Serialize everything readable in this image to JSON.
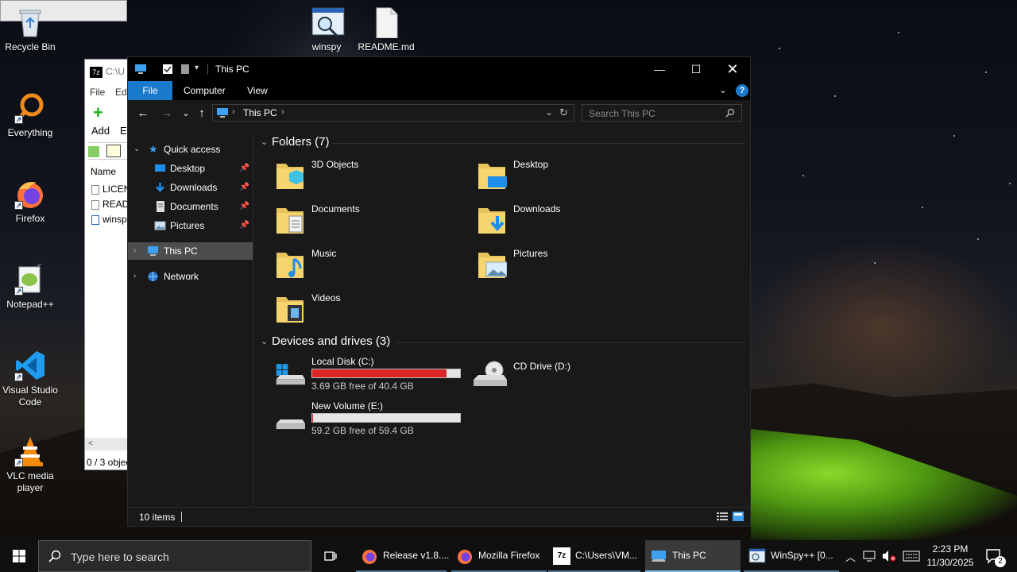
{
  "desktop": {
    "icons": [
      {
        "label": "Recycle Bin"
      },
      {
        "label": "Everything"
      },
      {
        "label": "Firefox"
      },
      {
        "label": "Notepad++"
      },
      {
        "label": "Visual Studio Code"
      },
      {
        "label": "VLC media player"
      },
      {
        "label": "winspy"
      },
      {
        "label": "README.md"
      }
    ]
  },
  "sevenzip": {
    "title": "C:\\U",
    "menu_file": "File",
    "menu_edit": "Edi",
    "add_label": "Add",
    "extract_label": "Ex",
    "col_name": "Name",
    "rows": [
      "LICEN",
      "READ",
      "winsp"
    ],
    "status": "0 / 3 objec"
  },
  "explorer": {
    "title": "This PC",
    "tabs": {
      "file": "File",
      "computer": "Computer",
      "view": "View"
    },
    "address": {
      "path": "This PC"
    },
    "search": {
      "placeholder": "Search This PC"
    },
    "nav": {
      "quick_access": "Quick access",
      "desktop": "Desktop",
      "downloads": "Downloads",
      "documents": "Documents",
      "pictures": "Pictures",
      "this_pc": "This PC",
      "network": "Network"
    },
    "folders_header": "Folders (7)",
    "folders": [
      "3D Objects",
      "Desktop",
      "Documents",
      "Downloads",
      "Music",
      "Pictures",
      "Videos"
    ],
    "devices_header": "Devices and drives (3)",
    "drives": {
      "c": {
        "name": "Local Disk (C:)",
        "free": "3.69 GB free of 40.4 GB",
        "used_fraction": 0.909
      },
      "d": {
        "name": "CD Drive (D:)"
      },
      "e": {
        "name": "New Volume (E:)",
        "free": "59.2 GB free of 59.4 GB",
        "used_fraction": 0.003
      }
    },
    "status": "10 items"
  },
  "taskbar": {
    "search_placeholder": "Type here to search",
    "apps": [
      "Release v1.8....",
      "Mozilla Firefox",
      "C:\\Users\\VM...",
      "This PC",
      "WinSpy++ [0..."
    ],
    "time": "2:23 PM",
    "date": "11/30/2025",
    "notification_count": "2"
  },
  "colors": {
    "accent": "#1979ca",
    "drive_full": "#da2626",
    "selection": "#4d4d4d"
  }
}
